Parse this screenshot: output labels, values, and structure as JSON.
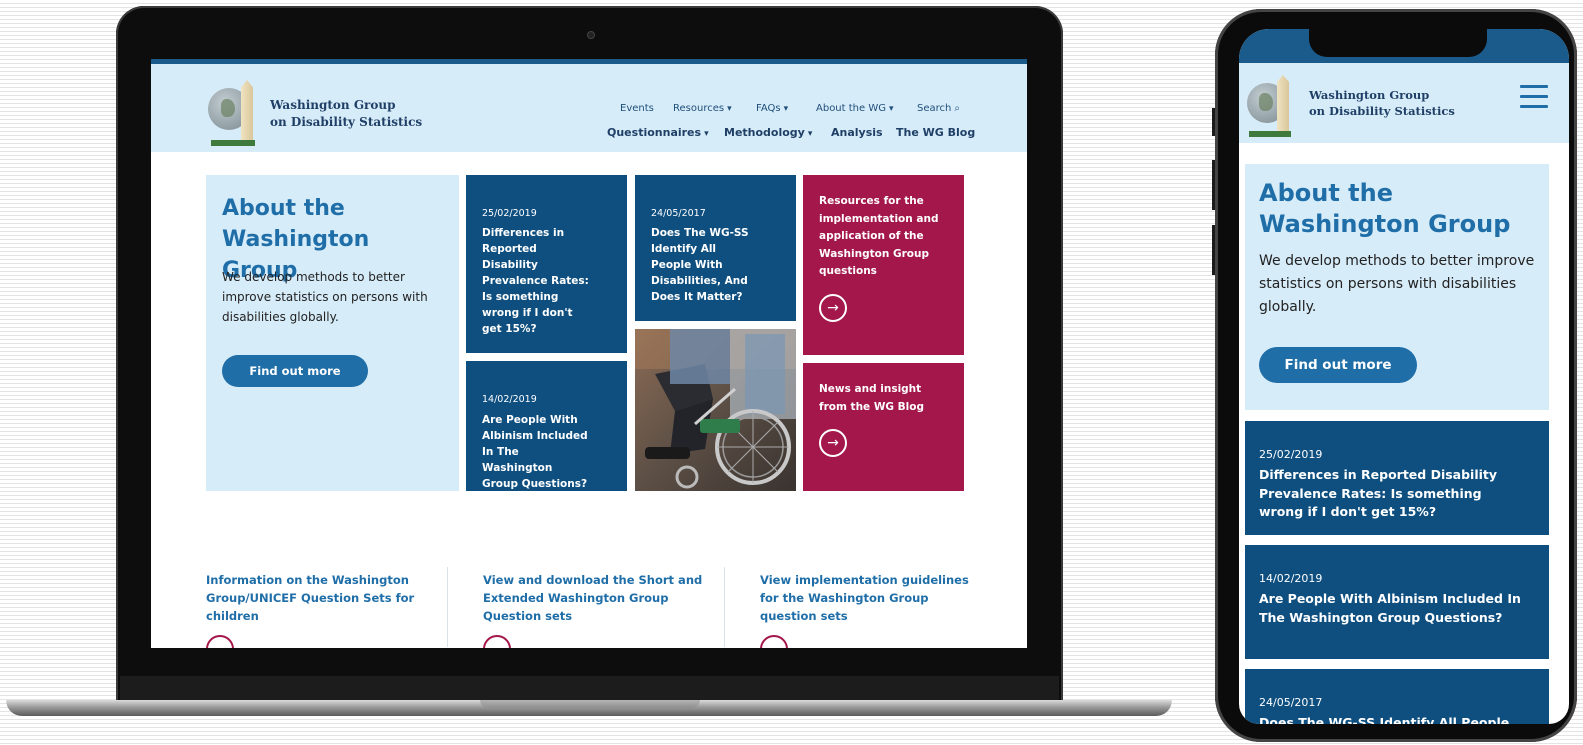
{
  "site": {
    "name_line1": "Washington Group",
    "name_line2": "on Disability Statistics"
  },
  "nav": {
    "top": [
      "Events",
      "Resources",
      "FAQs",
      "About the WG",
      "Search"
    ],
    "main": [
      "Questionnaires",
      "Methodology",
      "Analysis",
      "The WG Blog"
    ]
  },
  "about": {
    "title": "About the Washington Group",
    "text": "We develop methods to better improve statistics on persons with disabilities globally.",
    "button": "Find out more"
  },
  "posts": [
    {
      "date": "25/02/2019",
      "title": "Differences in Reported Disability Prevalence Rates: Is something wrong if I don't get 15%?"
    },
    {
      "date": "24/05/2017",
      "title": "Does The WG-SS Identify All People With Disabilities, And Does It Matter?"
    },
    {
      "date": "14/02/2019",
      "title": "Are People With Albinism Included In The Washington Group Questions?"
    }
  ],
  "promos": [
    {
      "title": "Resources for the implementation and application of the Washington Group questions"
    },
    {
      "title": "News and insight from the WG Blog"
    }
  ],
  "links": [
    "Information on the Washington Group/UNICEF Question Sets for children",
    "View and download the Short and Extended Washington Group Question sets",
    "View implementation guidelines for the Washington Group question sets"
  ],
  "mobile_partial_title": "Does The WG-SS Identify All People",
  "colors": {
    "brand_blue": "#1f6ea8",
    "dark_blue": "#0e4f80",
    "crimson": "#a3174a",
    "light_blue": "#d7ecf9"
  },
  "icons": [
    "chevron-down-icon",
    "search-icon",
    "arrow-right-circle-icon",
    "hamburger-menu-icon"
  ]
}
